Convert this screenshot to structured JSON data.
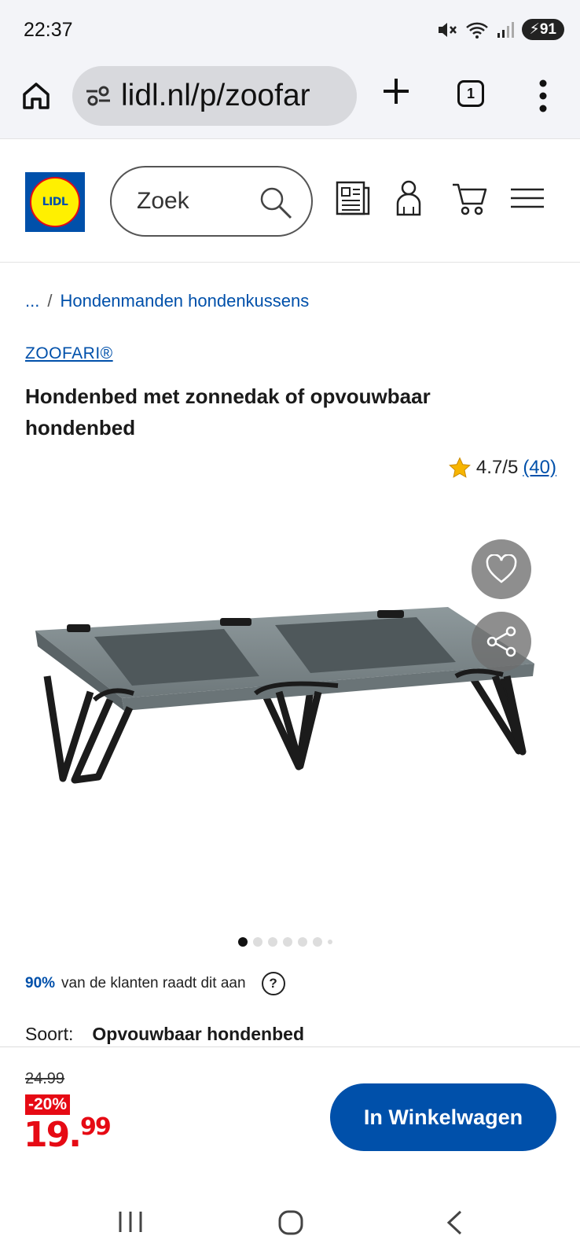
{
  "status": {
    "time": "22:37",
    "battery": "91",
    "signal_label": "6"
  },
  "browser": {
    "url": "lidl.nl/p/zoofar",
    "tab_count": "1"
  },
  "header": {
    "search_placeholder": "Zoek",
    "logo_text": "LIDL"
  },
  "breadcrumb": {
    "ellipsis": "...",
    "separator": "/",
    "category": "Hondenmanden hondenkussens"
  },
  "product": {
    "brand": "ZOOFARI®",
    "title": "Hondenbed met zonnedak of opvouwbaar hondenbed",
    "rating": "4.7/5",
    "rating_count": "(40)",
    "recommend_pct": "90%",
    "recommend_text": "van de klanten raadt dit aan",
    "help_label": "?",
    "variant_label": "Soort:",
    "variant_value": "Opvouwbaar hondenbed",
    "image_count": 7,
    "active_image": 0
  },
  "pricing": {
    "old_price": "24.99",
    "discount": "-20%",
    "price_main": "19.",
    "price_cents": "99",
    "cart_label": "In Winkelwagen"
  },
  "colors": {
    "brand_blue": "#0050aa",
    "brand_red": "#e60a14",
    "brand_yellow": "#fff000"
  },
  "icons": [
    "home-icon",
    "site-settings-icon",
    "plus-icon",
    "tabs-icon",
    "more-menu-icon",
    "search-icon",
    "leaflet-icon",
    "account-icon",
    "cart-icon",
    "hamburger-icon",
    "star-icon",
    "heart-icon",
    "share-icon",
    "recents-icon",
    "home-nav-icon",
    "back-icon"
  ]
}
